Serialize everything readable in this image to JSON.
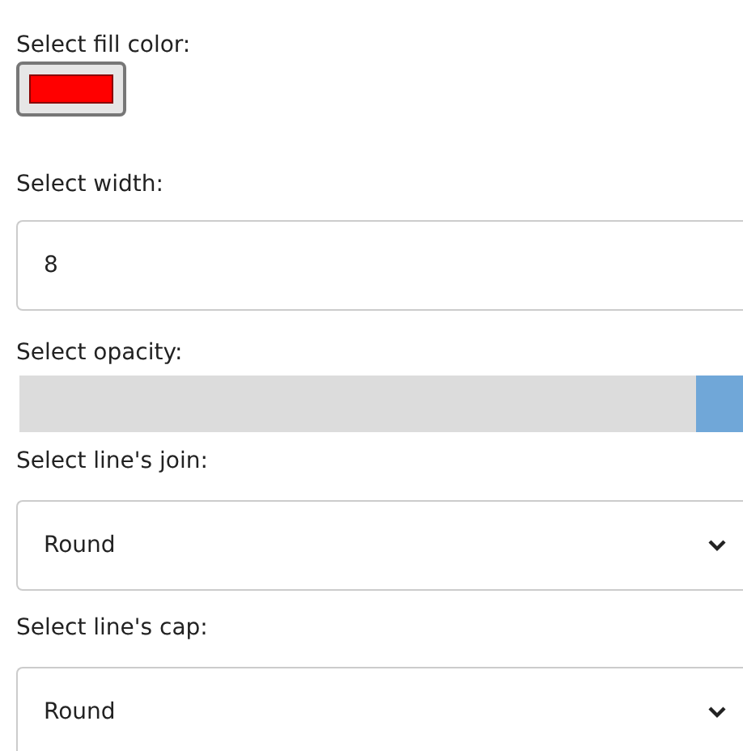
{
  "fields": [
    {
      "kind": "color",
      "label": "Select fill color:",
      "color": "#ff0000"
    },
    {
      "kind": "number",
      "label": "Select width:",
      "value": "8"
    },
    {
      "kind": "slider",
      "label": "Select opacity:",
      "level": 1
    },
    {
      "kind": "select",
      "label": "Select line's join:",
      "value": "Round"
    },
    {
      "kind": "select",
      "label": "Select line's cap:",
      "value": "Round"
    }
  ]
}
